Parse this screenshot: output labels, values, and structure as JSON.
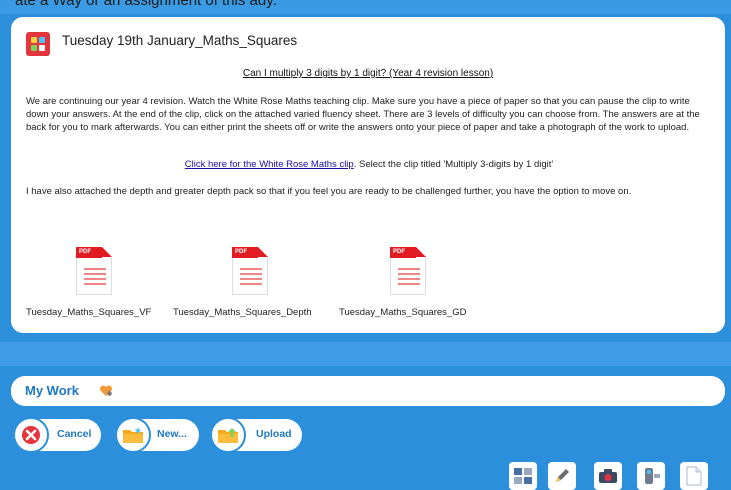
{
  "header": {
    "cropped_text": "ate a Way or an assignment of this ady."
  },
  "post": {
    "title": "Tuesday 19th January_Maths_Squares",
    "lesson_heading": "Can I multiply 3 digits by 1 digit? (Year 4 revision lesson)",
    "paragraph1": "We are continuing our year 4 revision. Watch the White Rose Maths teaching clip. Make sure you have a piece of paper so that you can pause the clip to write down your answers. At the end of the clip, click on the attached varied fluency sheet. There are 3 levels of difficulty you can choose from. The answers are at the back for you to mark afterwards. You can either print the sheets off or write the answers onto your piece of paper and take a photograph of the work to upload.",
    "link_text": "Click here for the White Rose Maths clip",
    "link_suffix": ". Select the clip titled 'Multiply 3-digits by 1 digit'",
    "paragraph3": "I have also attached the depth and greater depth pack so that if you feel you are ready to be challenged further, you have the option to move on.",
    "pdf_band": "PDF",
    "attachments": [
      {
        "name": "Tuesday_Maths_Squares_VF"
      },
      {
        "name": "Tuesday_Maths_Squares_Depth"
      },
      {
        "name": "Tuesday_Maths_Squares_GD"
      }
    ]
  },
  "my_work": {
    "label": "My Work"
  },
  "actions": {
    "cancel": "Cancel",
    "new": "New...",
    "upload": "Upload"
  },
  "toolbar": {
    "icons": [
      "grid-icon",
      "pen-icon",
      "camera-icon",
      "video-camera-icon",
      "document-icon"
    ]
  },
  "colors": {
    "background": "#2b8fdb",
    "accent": "#1f78c2",
    "pdf_red": "#e21a22",
    "cancel_red": "#e4353c"
  }
}
